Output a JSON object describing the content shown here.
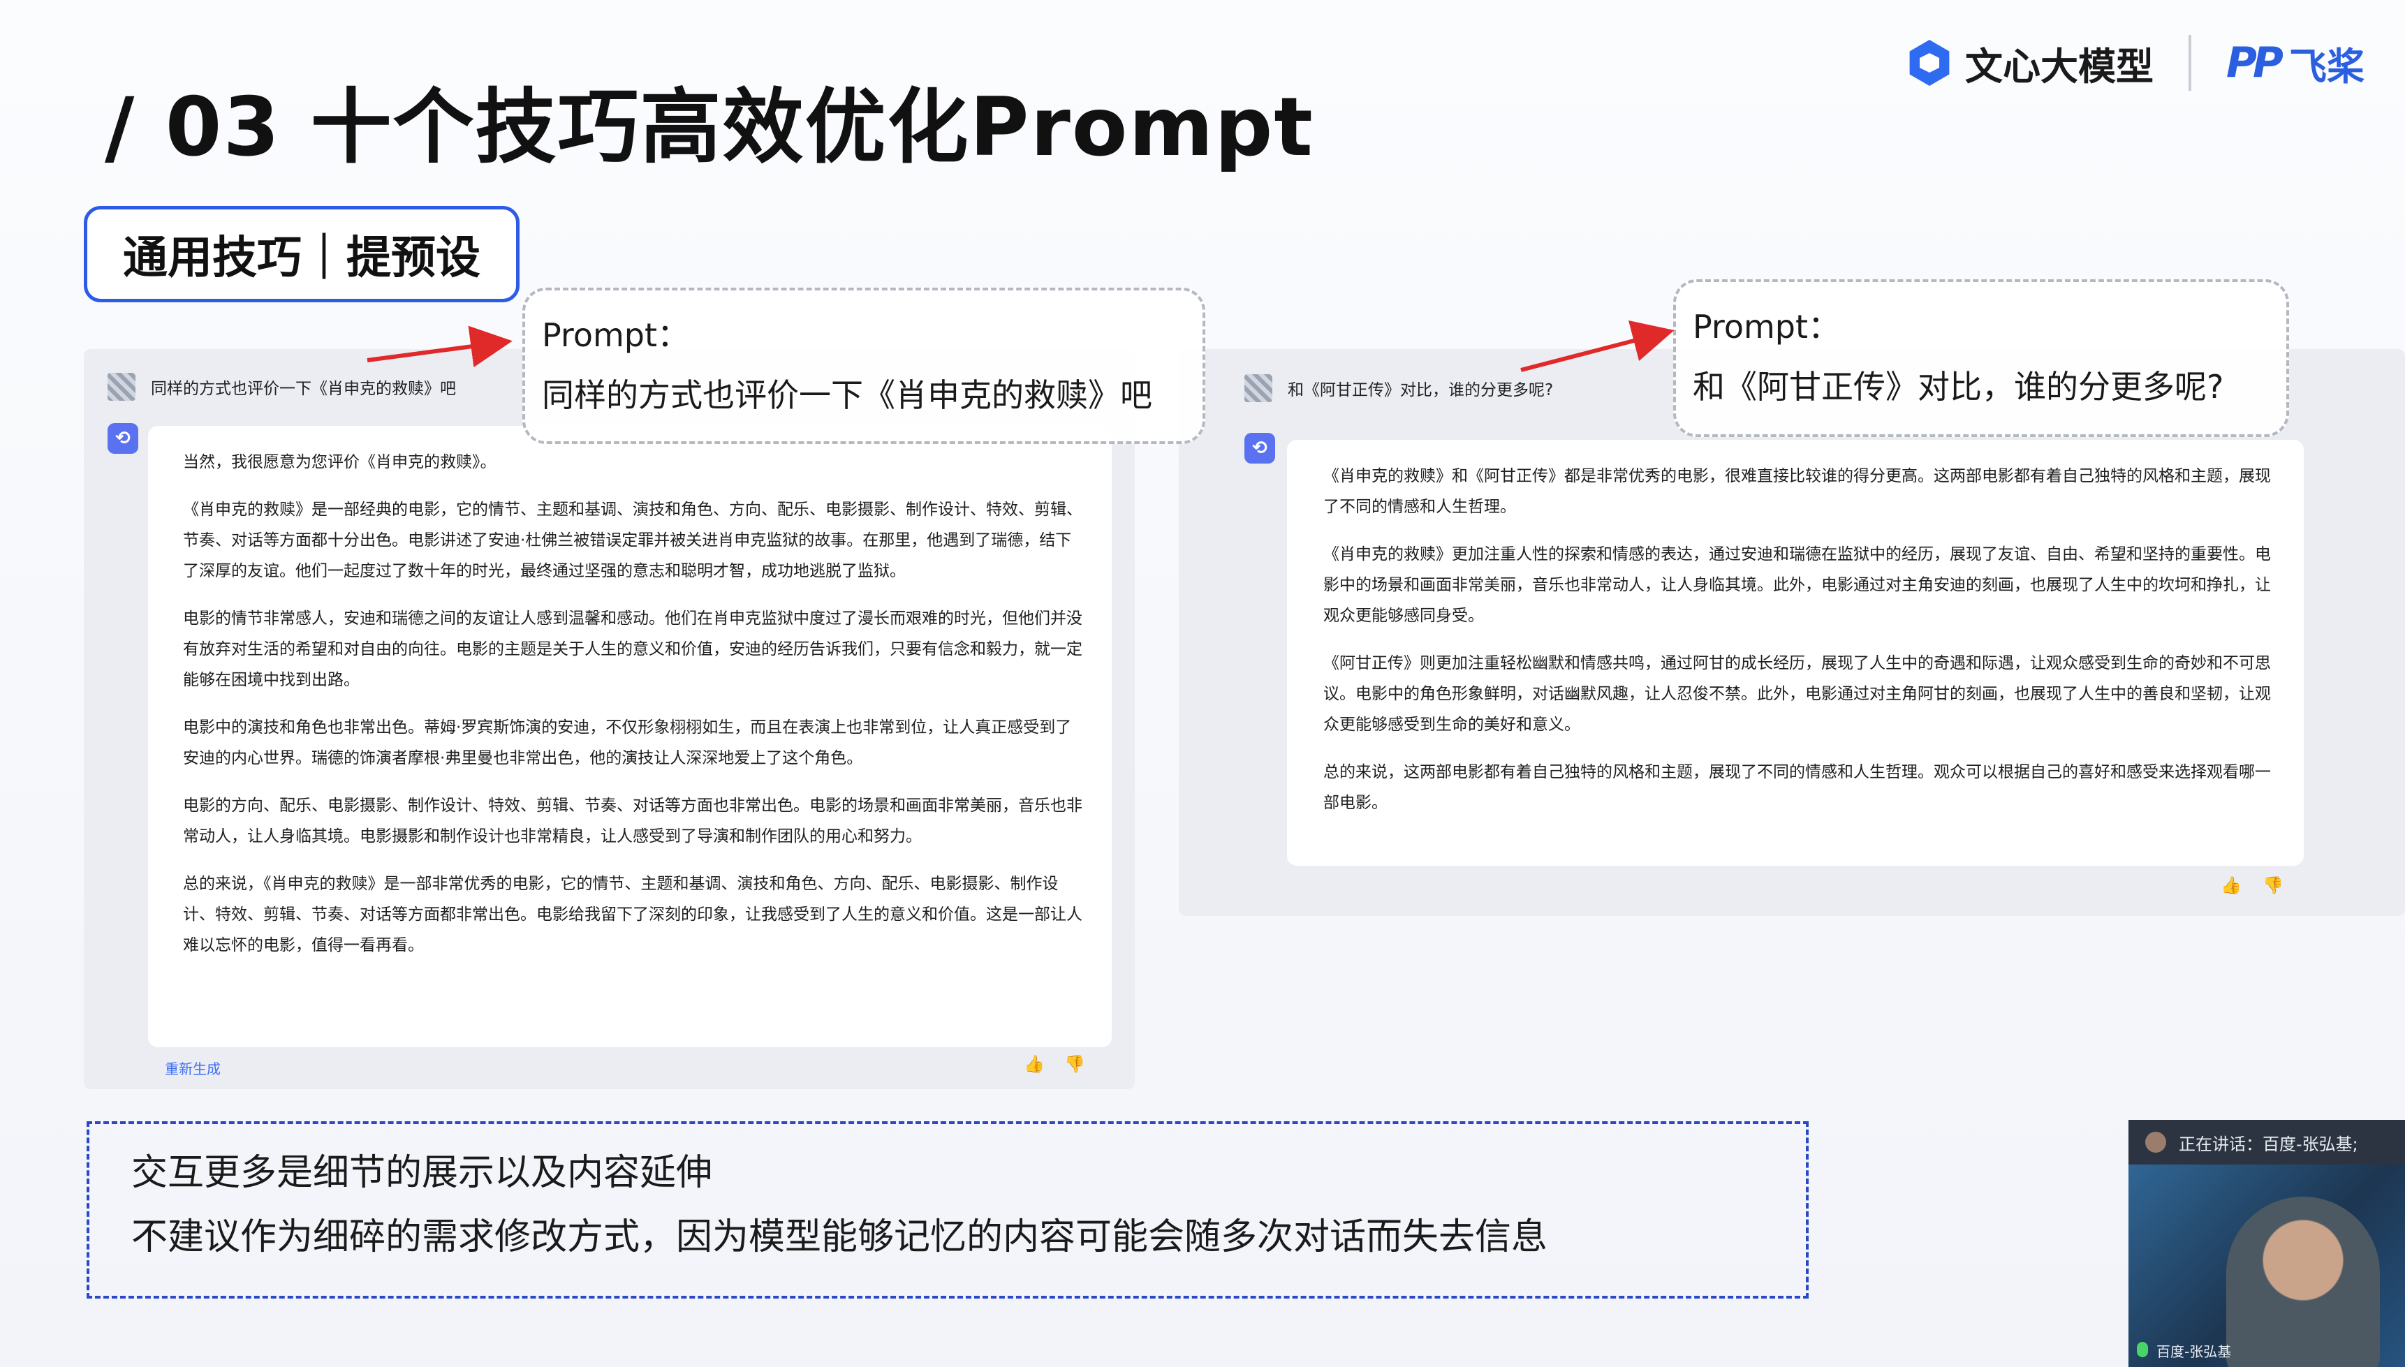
{
  "slide": {
    "title": "/ 03  十个技巧高效优化Prompt",
    "brand": {
      "wenxin": "文心大模型",
      "pp_logo": "PP",
      "feijiang": "飞桨"
    },
    "tag": "通用技巧｜提预设"
  },
  "left_chat": {
    "question": "同样的方式也评价一下《肖申克的救赎》吧",
    "bot_icon": "⟲",
    "answer": [
      "当然，我很愿意为您评价《肖申克的救赎》。",
      "《肖申克的救赎》是一部经典的电影，它的情节、主题和基调、演技和角色、方向、配乐、电影摄影、制作设计、特效、剪辑、节奏、对话等方面都十分出色。电影讲述了安迪·杜佛兰被错误定罪并被关进肖申克监狱的故事。在那里，他遇到了瑞德，结下了深厚的友谊。他们一起度过了数十年的时光，最终通过坚强的意志和聪明才智，成功地逃脱了监狱。",
      "电影的情节非常感人，安迪和瑞德之间的友谊让人感到温馨和感动。他们在肖申克监狱中度过了漫长而艰难的时光，但他们并没有放弃对生活的希望和对自由的向往。电影的主题是关于人生的意义和价值，安迪的经历告诉我们，只要有信念和毅力，就一定能够在困境中找到出路。",
      "电影中的演技和角色也非常出色。蒂姆·罗宾斯饰演的安迪，不仅形象栩栩如生，而且在表演上也非常到位，让人真正感受到了安迪的内心世界。瑞德的饰演者摩根·弗里曼也非常出色，他的演技让人深深地爱上了这个角色。",
      "电影的方向、配乐、电影摄影、制作设计、特效、剪辑、节奏、对话等方面也非常出色。电影的场景和画面非常美丽，音乐也非常动人，让人身临其境。电影摄影和制作设计也非常精良，让人感受到了导演和制作团队的用心和努力。",
      "总的来说，《肖申克的救赎》是一部非常优秀的电影，它的情节、主题和基调、演技和角色、方向、配乐、电影摄影、制作设计、特效、剪辑、节奏、对话等方面都非常出色。电影给我留下了深刻的印象，让我感受到了人生的意义和价值。这是一部让人难以忘怀的电影，值得一看再看。"
    ],
    "regenerate": "重新生成"
  },
  "right_chat": {
    "question": "和《阿甘正传》对比，谁的分更多呢?",
    "bot_icon": "⟲",
    "answer": [
      "《肖申克的救赎》和《阿甘正传》都是非常优秀的电影，很难直接比较谁的得分更高。这两部电影都有着自己独特的风格和主题，展现了不同的情感和人生哲理。",
      "《肖申克的救赎》更加注重人性的探索和情感的表达，通过安迪和瑞德在监狱中的经历，展现了友谊、自由、希望和坚持的重要性。电影中的场景和画面非常美丽，音乐也非常动人，让人身临其境。此外，电影通过对主角安迪的刻画，也展现了人生中的坎坷和挣扎，让观众更能够感同身受。",
      "《阿甘正传》则更加注重轻松幽默和情感共鸣，通过阿甘的成长经历，展现了人生中的奇遇和际遇，让观众感受到生命的奇妙和不可思议。电影中的角色形象鲜明，对话幽默风趣，让人忍俊不禁。此外，电影通过对主角阿甘的刻画，也展现了人生中的善良和坚韧，让观众更能够感受到生命的美好和意义。",
      "总的来说，这两部电影都有着自己独特的风格和主题，展现了不同的情感和人生哲理。观众可以根据自己的喜好和感受来选择观看哪一部电影。"
    ]
  },
  "prompt_left": {
    "label": "Prompt：",
    "text": "同样的方式也评价一下《肖申克的救赎》吧"
  },
  "prompt_right": {
    "label": "Prompt：",
    "text": "和《阿甘正传》对比，谁的分更多呢?"
  },
  "feedback": {
    "like": "👍",
    "dislike": "👎"
  },
  "note": {
    "line1": "交互更多是细节的展示以及内容延伸",
    "line2": "不建议作为细碎的需求修改方式，因为模型能够记忆的内容可能会随多次对话而失去信息"
  },
  "webcam": {
    "status": "正在讲话：百度-张弘基;",
    "name": "百度-张弘基"
  },
  "colors": {
    "accent": "#2c5ce6",
    "arrow": "#e02a2a",
    "note_border": "#2a48c8",
    "bot": "#5b72f0"
  }
}
